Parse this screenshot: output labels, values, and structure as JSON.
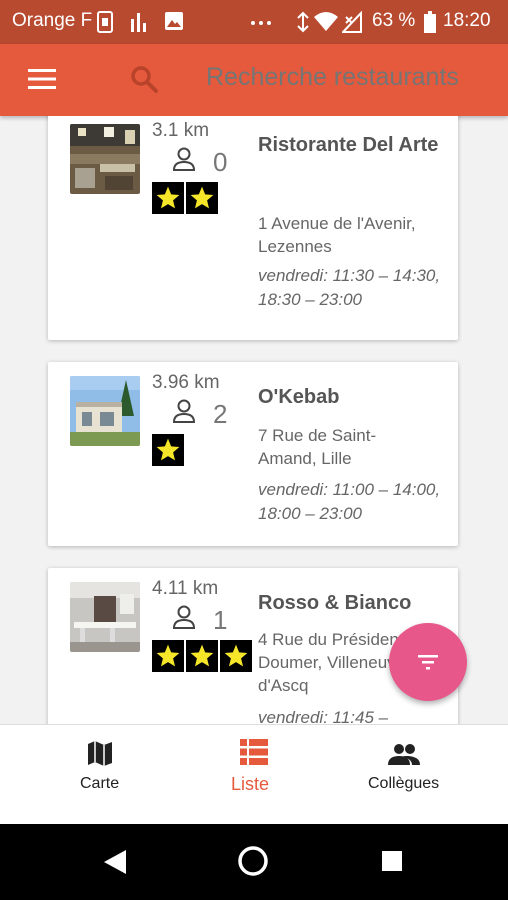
{
  "status_bar": {
    "carrier": "Orange F",
    "battery_percent": "63 %",
    "time": "18:20"
  },
  "app_bar": {
    "search_placeholder": "Recherche restaurants",
    "color": "#e55a3c"
  },
  "restaurants": [
    {
      "distance": "3.1 km",
      "people_count": "0",
      "stars": 2,
      "name": "Ristorante Del Arte",
      "address": "1 Avenue de l'Avenir, Lezennes",
      "hours": "vendredi: 11:30 – 14:30, 18:30 – 23:00"
    },
    {
      "distance": "3.96 km",
      "people_count": "2",
      "stars": 1,
      "name": "O'Kebab",
      "address": "7 Rue de Saint-Amand, Lille",
      "hours": "vendredi: 11:00 – 14:00, 18:00 – 23:00"
    },
    {
      "distance": "4.11 km",
      "people_count": "1",
      "stars": 3,
      "name": "Rosso & Bianco",
      "address": "4 Rue du Président Paul Doumer, Villeneuve-d'Ascq",
      "hours": "vendredi: 11:45 –"
    }
  ],
  "bottom_nav": {
    "items": [
      {
        "label": "Carte",
        "icon": "map-icon"
      },
      {
        "label": "Liste",
        "icon": "list-icon",
        "active": true
      },
      {
        "label": "Collègues",
        "icon": "people-icon"
      }
    ]
  },
  "fab": {
    "icon": "filter-icon",
    "color": "#e8578a"
  },
  "system_nav": {
    "items": [
      "back-icon",
      "home-icon",
      "recents-icon"
    ]
  }
}
